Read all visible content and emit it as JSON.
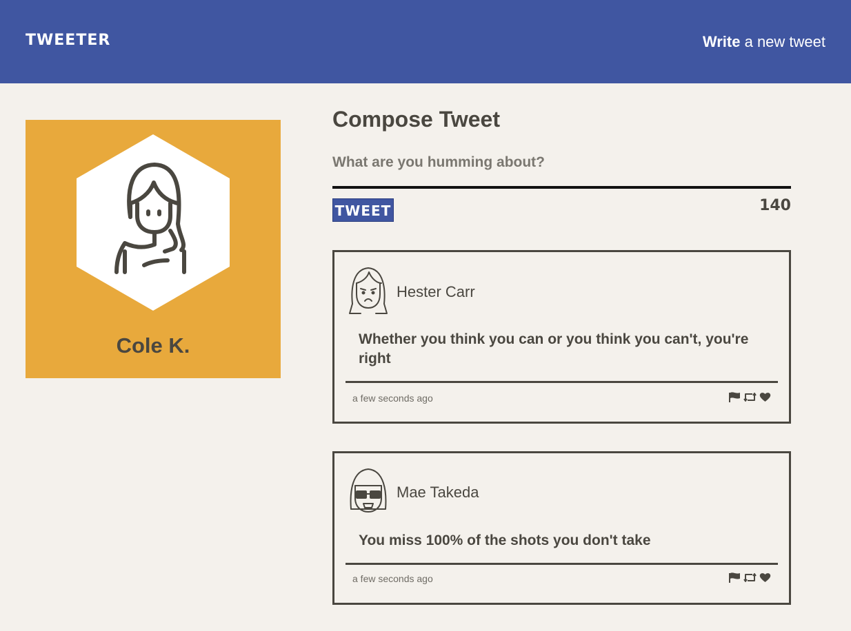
{
  "header": {
    "brand": "TWEETER",
    "write_bold": "Write",
    "write_rest": " a new tweet",
    "background_color": "#4056a1"
  },
  "profile": {
    "name": "Cole K.",
    "background_color": "#e8a93c",
    "avatar_icon": "person-long-hair-icon"
  },
  "compose": {
    "title": "Compose Tweet",
    "placeholder": "What are you humming about?",
    "submit_label": "TWEET",
    "char_count": "140"
  },
  "tweets": [
    {
      "author": "Hester Carr",
      "avatar_icon": "sad-girl-avatar-icon",
      "content": "Whether you think you can or you think you can't, you're right",
      "timestamp": "a few seconds ago"
    },
    {
      "author": "Mae Takeda",
      "avatar_icon": "girl-with-glasses-avatar-icon",
      "content": "You miss 100% of the shots you don't take",
      "timestamp": "a few seconds ago"
    }
  ],
  "action_icons": [
    "flag-icon",
    "retweet-icon",
    "heart-icon"
  ]
}
